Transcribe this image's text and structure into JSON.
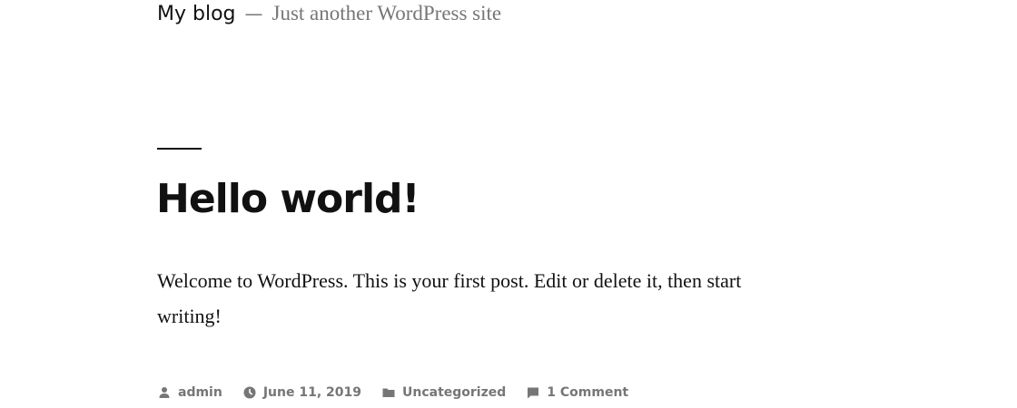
{
  "header": {
    "site_title": "My blog",
    "separator": "—",
    "tagline": "Just another WordPress site"
  },
  "post": {
    "title": "Hello world!",
    "content": "Welcome to WordPress. This is your first post. Edit or delete it, then start writing!",
    "meta": {
      "author": "admin",
      "date": "June 11, 2019",
      "category": "Uncategorized",
      "comments": "1 Comment"
    },
    "icons": {
      "author": "person-icon",
      "date": "clock-icon",
      "category": "folder-icon",
      "comments": "comment-icon"
    }
  }
}
